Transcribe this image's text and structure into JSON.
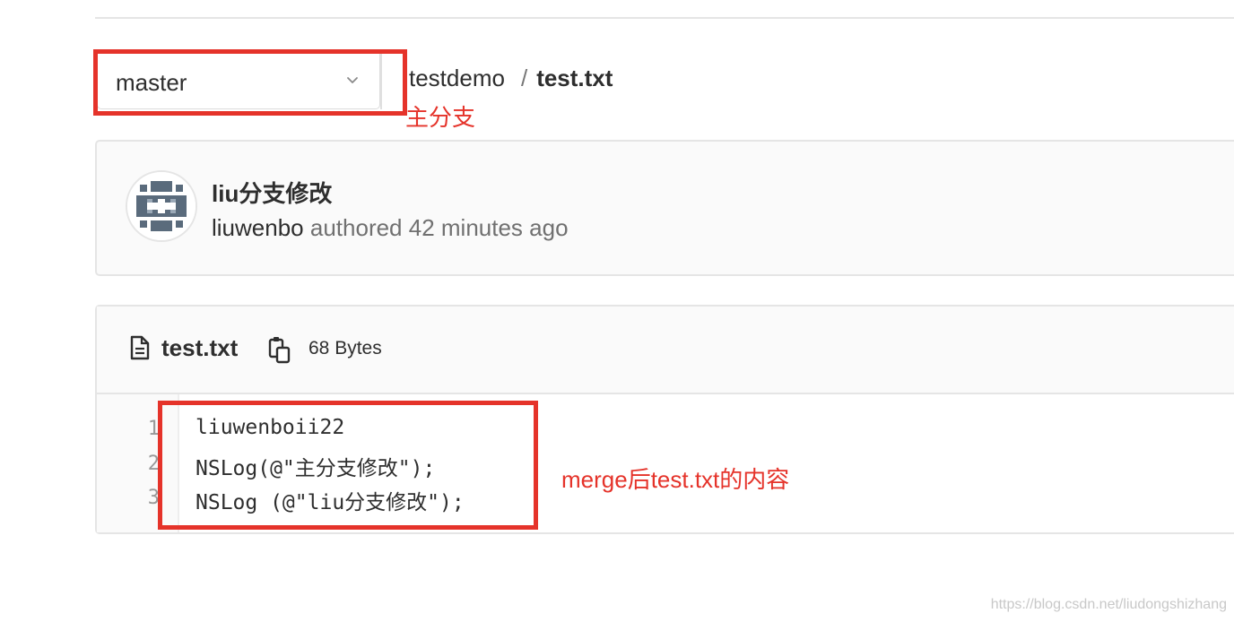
{
  "branch": {
    "selected": "master"
  },
  "breadcrumb": {
    "project": "testdemo",
    "separator": "/",
    "file": "test.txt"
  },
  "annotations": {
    "branch_note": "主分支",
    "content_note": "merge后test.txt的内容"
  },
  "commit": {
    "title": "liu分支修改",
    "author": "liuwenbo",
    "meta": "authored 42 minutes ago"
  },
  "file": {
    "name": "test.txt",
    "size": "68 Bytes",
    "lines": [
      {
        "num": "1",
        "text": "liuwenboii22"
      },
      {
        "num": "2",
        "text": "NSLog(@\"主分支修改\");"
      },
      {
        "num": "3",
        "text": "NSLog (@\"liu分支修改\");"
      }
    ]
  },
  "watermark": "https://blog.csdn.net/liudongshizhang",
  "colors": {
    "annotation_red": "#e5332a",
    "border": "#e5e5e5",
    "panel_bg": "#fafafa"
  }
}
